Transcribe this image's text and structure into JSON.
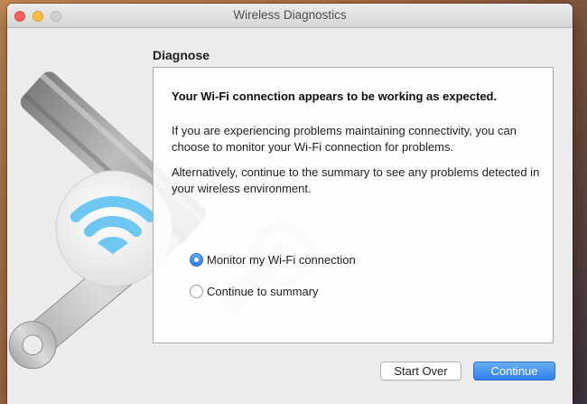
{
  "window": {
    "title": "Wireless Diagnostics"
  },
  "colors": {
    "accent": "#3a8cf0",
    "close": "#fc605c",
    "minimize": "#fdbc40",
    "zoom_disabled": "#d0d0d0",
    "wifi_icon": "#6ec6f2"
  },
  "illustration": {
    "icon": "wifi-wrench-icon"
  },
  "main": {
    "heading": "Diagnose",
    "headline": "Your Wi-Fi connection appears to be working as expected.",
    "paragraph1": "If you are experiencing problems maintaining connectivity, you can choose to monitor your Wi-Fi connection for problems.",
    "paragraph2": "Alternatively, continue to the summary to see any problems detected in your wireless environment."
  },
  "options": {
    "monitor_label": "Monitor my Wi-Fi connection",
    "summary_label": "Continue to summary",
    "selected": "Monitor my Wi-Fi connection"
  },
  "buttons": {
    "start_over": "Start Over",
    "continue": "Continue"
  }
}
